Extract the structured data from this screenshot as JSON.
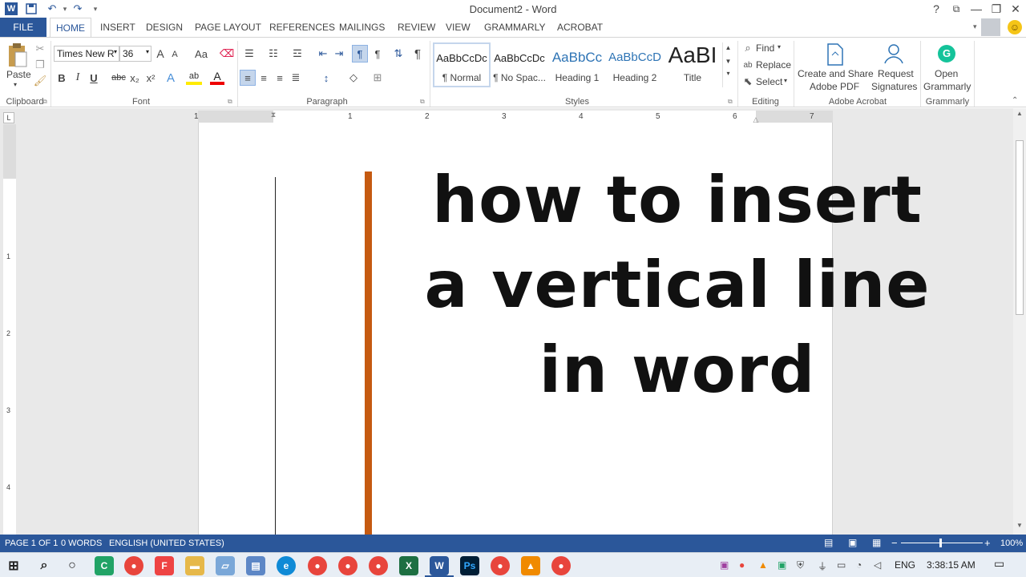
{
  "window": {
    "title": "Document2 - Word",
    "help": "?",
    "restore_ribbon": "⧉",
    "minimize": "—",
    "maximize": "❐",
    "close": "✕"
  },
  "quick_access": {
    "word_icon": "W",
    "save": "💾",
    "undo": "↶",
    "redo": "↷",
    "customize": "▾"
  },
  "tabs": {
    "file": "FILE",
    "items": [
      "HOME",
      "INSERT",
      "DESIGN",
      "PAGE LAYOUT",
      "REFERENCES",
      "MAILINGS",
      "REVIEW",
      "VIEW",
      "GRAMMARLY",
      "ACROBAT"
    ]
  },
  "ribbon": {
    "clipboard": {
      "paste": "Paste",
      "group": "Clipboard"
    },
    "font": {
      "family": "Times New R",
      "size": "36",
      "group": "Font",
      "bold": "B",
      "italic": "I",
      "underline": "U",
      "strike": "abc",
      "sub": "x₂",
      "sup": "x²",
      "grow": "A",
      "shrink": "A",
      "case": "Aa",
      "color": "A"
    },
    "paragraph": {
      "group": "Paragraph",
      "pilcrow": "¶"
    },
    "styles": {
      "group": "Styles",
      "items": [
        {
          "sample": "AaBbCcDc",
          "name": "¶ Normal"
        },
        {
          "sample": "AaBbCcDc",
          "name": "¶ No Spac..."
        },
        {
          "sample": "AaBbCc",
          "name": "Heading 1"
        },
        {
          "sample": "AaBbCcD",
          "name": "Heading 2"
        },
        {
          "sample": "AaBI",
          "name": "Title"
        }
      ]
    },
    "editing": {
      "group": "Editing",
      "find": "Find",
      "replace": "Replace",
      "select": "Select"
    },
    "acrobat": {
      "group": "Adobe Acrobat",
      "create_line1": "Create and Share",
      "create_line2": "Adobe PDF",
      "request_line1": "Request",
      "request_line2": "Signatures"
    },
    "grammarly": {
      "group": "Grammarly",
      "open_line1": "Open",
      "open_line2": "Grammarly"
    }
  },
  "ruler": {
    "numbers": [
      "1",
      "1",
      "2",
      "3",
      "4",
      "5",
      "6",
      "7"
    ],
    "vertical_numbers": [
      "1",
      "2",
      "3",
      "4"
    ],
    "tab_selector": "L"
  },
  "document": {
    "lines": [
      "how to insert",
      "a vertical line",
      "in word"
    ],
    "accent_color": "#c55a11"
  },
  "status": {
    "page": "PAGE 1 OF 1",
    "words": "0 WORDS",
    "language": "ENGLISH (UNITED STATES)",
    "zoom_minus": "−",
    "zoom_plus": "+",
    "zoom": "100%"
  },
  "taskbar": {
    "language": "ENG",
    "time": "3:38:15 AM"
  }
}
